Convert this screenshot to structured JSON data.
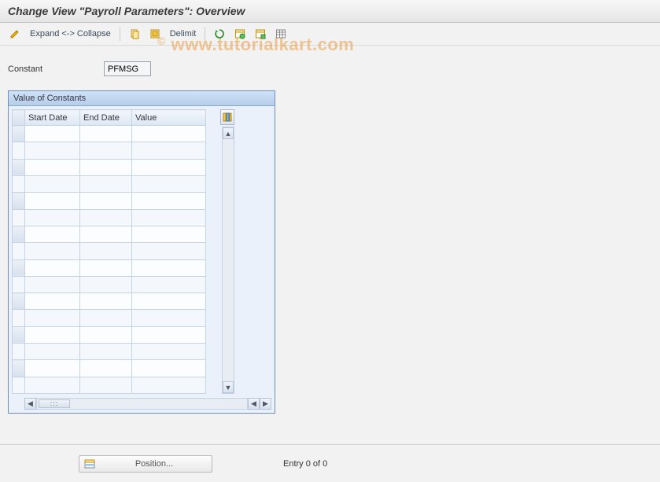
{
  "title": "Change View \"Payroll Parameters\": Overview",
  "toolbar": {
    "expand_collapse_label": "Expand <-> Collapse",
    "delimit_label": "Delimit"
  },
  "constant": {
    "label": "Constant",
    "value": "PFMSG"
  },
  "panel": {
    "title": "Value of Constants",
    "columns": {
      "start_date": "Start Date",
      "end_date": "End Date",
      "value": "Value"
    }
  },
  "hscroll": {
    "thumb_label": ":::"
  },
  "footer": {
    "position_label": "Position...",
    "entry_label": "Entry 0 of 0"
  },
  "watermark": {
    "copy": "©",
    "text": "www.tutorialkart.com"
  }
}
